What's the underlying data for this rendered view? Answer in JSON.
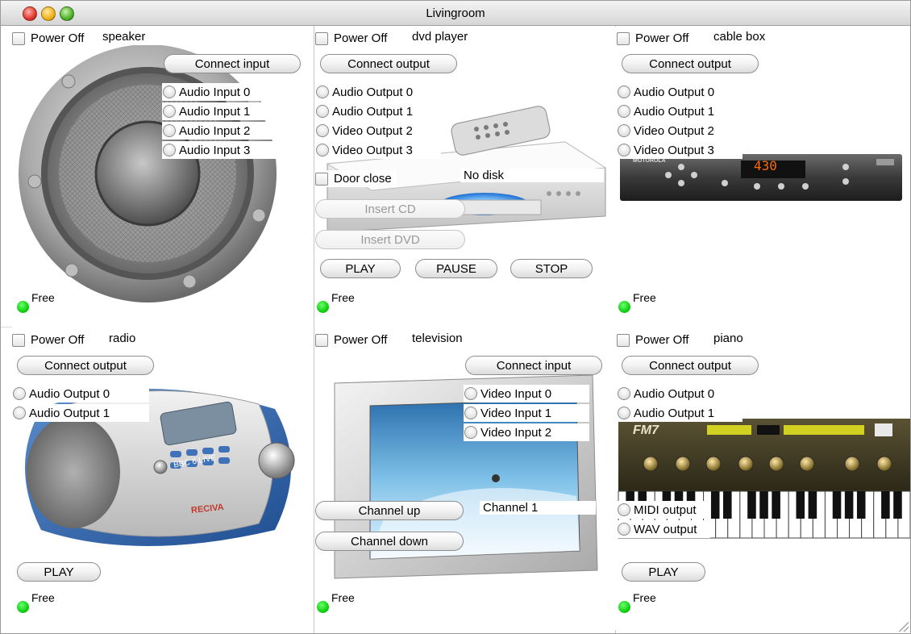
{
  "window": {
    "title": "Livingroom"
  },
  "power_label": "Power Off",
  "free_label": "Free",
  "speaker": {
    "name": "speaker",
    "connect_label": "Connect input",
    "ports": [
      "Audio Input 0",
      "Audio Input 1",
      "Audio Input 2",
      "Audio Input 3"
    ]
  },
  "dvd": {
    "name": "dvd player",
    "connect_label": "Connect output",
    "ports": [
      "Audio Output 0",
      "Audio Output 1",
      "Video Output 2",
      "Video Output 3"
    ],
    "door_label": "Door close",
    "disk_status": "No disk",
    "insert_cd": "Insert CD",
    "insert_dvd": "Insert DVD",
    "play": "PLAY",
    "pause": "PAUSE",
    "stop": "STOP"
  },
  "cable": {
    "name": "cable box",
    "connect_label": "Connect output",
    "ports": [
      "Audio Output 0",
      "Audio Output 1",
      "Video Output 2",
      "Video Output 3"
    ],
    "brand": "MOTOROLA",
    "channel_display": "430"
  },
  "radio": {
    "name": "radio",
    "connect_label": "Connect output",
    "ports": [
      "Audio Output 0",
      "Audio Output 1"
    ],
    "play": "PLAY",
    "brand": "RECIVA",
    "screen": "BBC 6 LIVE"
  },
  "tv": {
    "name": "television",
    "connect_label": "Connect input",
    "ports": [
      "Video Input 0",
      "Video Input 1",
      "Video Input 2"
    ],
    "channel_up": "Channel up",
    "channel_down": "Channel down",
    "channel_status": "Channel 1"
  },
  "piano": {
    "name": "piano",
    "connect_label": "Connect output",
    "ports": [
      "Audio Output 0",
      "Audio Output 1",
      "MIDI output",
      "WAV output"
    ],
    "play": "PLAY",
    "brand": "FM7"
  },
  "colors": {
    "led": "#10d010",
    "lcd": "#ff6a00"
  }
}
